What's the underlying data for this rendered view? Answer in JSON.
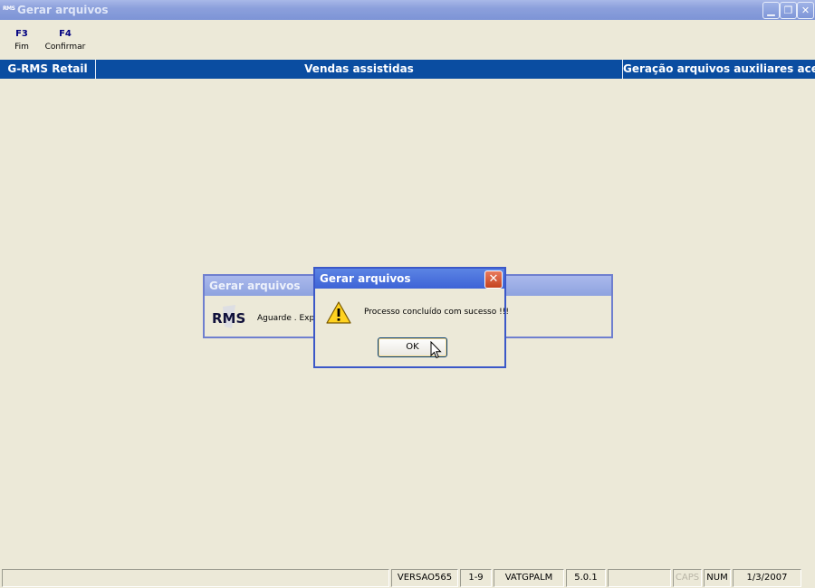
{
  "window": {
    "app_icon": "RMS",
    "title": "Gerar arquivos",
    "controls": [
      "minimize-icon",
      "restore-icon",
      "close-icon"
    ]
  },
  "toolbar": {
    "buttons": [
      {
        "key": "F3",
        "label": "Fim"
      },
      {
        "key": "F4",
        "label": "Confirmar"
      }
    ]
  },
  "header": {
    "left": "G-RMS Retail",
    "center": "Vendas assistidas",
    "right": "Geração arquivos auxiliares acesso"
  },
  "progress_dialog": {
    "title": "Gerar arquivos",
    "logo": "RMS",
    "message": "Aguarde . Expo"
  },
  "message_box": {
    "title": "Gerar arquivos",
    "icon": "warning-icon",
    "text": "Processo concluído com sucesso !!!",
    "ok_label": "OK"
  },
  "statusbar": {
    "fields": [
      "",
      "VERSAO565",
      "1-9",
      "VATGPALM",
      "5.0.1",
      "",
      "CAPS",
      "NUM",
      "1/3/2007"
    ]
  }
}
